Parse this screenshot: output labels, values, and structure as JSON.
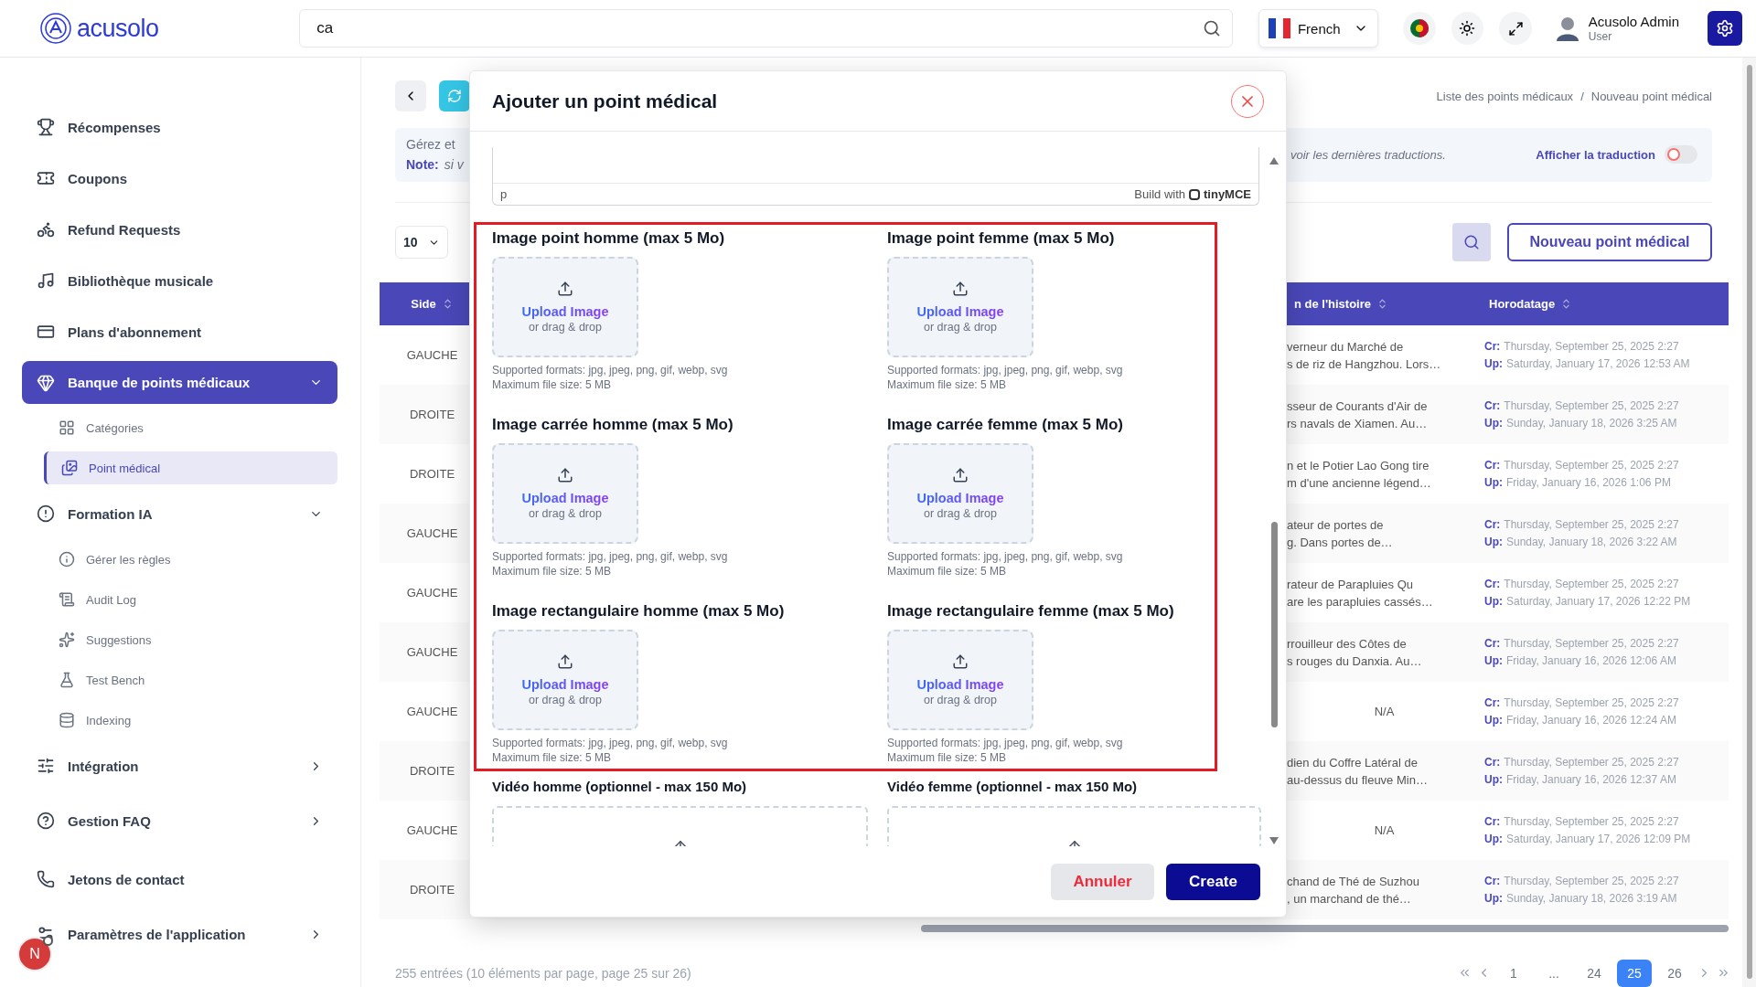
{
  "header": {
    "logo": "acusolo",
    "search": {
      "value": "ca"
    },
    "language": "French",
    "user": {
      "name": "Acusolo Admin",
      "role": "User"
    }
  },
  "sidebar": {
    "items": [
      {
        "label": "Récompenses",
        "selected": false
      },
      {
        "label": "Coupons",
        "selected": false
      },
      {
        "label": "Refund Requests",
        "selected": false
      },
      {
        "label": "Bibliothèque musicale",
        "selected": false
      },
      {
        "label": "Plans d'abonnement",
        "selected": false
      },
      {
        "label": "Banque de points médicaux",
        "selected": true,
        "expanded": true,
        "children": [
          {
            "label": "Catégories",
            "selected": false
          },
          {
            "label": "Point médical",
            "selected": true
          }
        ]
      },
      {
        "label": "Formation IA",
        "selected": false,
        "expanded": true,
        "children": [
          {
            "label": "Gérer les règles",
            "selected": false
          },
          {
            "label": "Audit Log",
            "selected": false
          },
          {
            "label": "Suggestions",
            "selected": false
          },
          {
            "label": "Test Bench",
            "selected": false
          },
          {
            "label": "Indexing",
            "selected": false
          }
        ]
      },
      {
        "label": "Intégration",
        "selected": false,
        "expanded": false
      },
      {
        "label": "Gestion FAQ",
        "selected": false,
        "expanded": false
      },
      {
        "label": "Jetons de contact",
        "selected": false
      },
      {
        "label": "Paramètres de l'application",
        "selected": false,
        "expanded": false
      }
    ]
  },
  "dev_badge": "N",
  "page": {
    "breadcrumb": {
      "items": [
        "Liste des points médicaux",
        "Nouveau point médical"
      ],
      "separator": "/"
    },
    "info": {
      "text": "Gérez et",
      "note_label": "Note:",
      "note_text": "si v",
      "right_text": "voir les dernières traductions."
    },
    "translation_toggle": {
      "label": "Afficher la traduction",
      "on": false
    },
    "per_page": "10",
    "new_button": "Nouveau point médical",
    "table": {
      "columns": [
        "Side",
        "",
        "n de l'histoire",
        "Horodatage"
      ],
      "rows": [
        {
          "side": "GAUCHE",
          "story": [
            "verneur du Marché de",
            "s de riz de Hangzhou. Lors…"
          ],
          "created_label": "Cr:",
          "created": "Thursday, September 25, 2025 2:27",
          "updated_label": "Up:",
          "updated": "Saturday, January 17, 2026 12:53 AM"
        },
        {
          "side": "DROITE",
          "story": [
            "sseur de Courants d'Air de",
            "rs navals de Xiamen. Au…"
          ],
          "created_label": "Cr:",
          "created": "Thursday, September 25, 2025 2:27",
          "updated_label": "Up:",
          "updated": "Sunday, January 18, 2026 3:25 AM"
        },
        {
          "side": "DROITE",
          "story": [
            "n et le Potier Lao Gong tire",
            "m d'une ancienne légend…"
          ],
          "created_label": "Cr:",
          "created": "Thursday, September 25, 2025 2:27",
          "updated_label": "Up:",
          "updated": "Friday, January 16, 2026 1:06 PM"
        },
        {
          "side": "GAUCHE",
          "story": [
            "ateur de portes de",
            "g. Dans portes de…"
          ],
          "created_label": "Cr:",
          "created": "Thursday, September 25, 2025 2:27",
          "updated_label": "Up:",
          "updated": "Sunday, January 18, 2026 3:22 AM"
        },
        {
          "side": "GAUCHE",
          "story": [
            "rateur de Parapluies Qu",
            "are les parapluies cassés…"
          ],
          "created_label": "Cr:",
          "created": "Thursday, September 25, 2025 2:27",
          "updated_label": "Up:",
          "updated": "Saturday, January 17, 2026 12:22 PM"
        },
        {
          "side": "GAUCHE",
          "story": [
            "rrouilleur des Côtes de",
            "s rouges du Danxia. Au…"
          ],
          "created_label": "Cr:",
          "created": "Thursday, September 25, 2025 2:27",
          "updated_label": "Up:",
          "updated": "Friday, January 16, 2026 12:06 AM"
        },
        {
          "side": "GAUCHE",
          "story": [
            "N/A"
          ],
          "created_label": "Cr:",
          "created": "Thursday, September 25, 2025 2:27",
          "updated_label": "Up:",
          "updated": "Friday, January 16, 2026 12:24 AM"
        },
        {
          "side": "DROITE",
          "story": [
            "dien du Coffre Latéral de",
            "au-dessus du fleuve Min…"
          ],
          "created_label": "Cr:",
          "created": "Thursday, September 25, 2025 2:27",
          "updated_label": "Up:",
          "updated": "Friday, January 16, 2026 12:37 AM"
        },
        {
          "side": "GAUCHE",
          "story": [
            "N/A"
          ],
          "created_label": "Cr:",
          "created": "Thursday, September 25, 2025 2:27",
          "updated_label": "Up:",
          "updated": "Saturday, January 17, 2026 12:09 PM"
        },
        {
          "side": "DROITE",
          "story": [
            "chand de Thé de Suzhou",
            ", un marchand de thé…"
          ],
          "created_label": "Cr:",
          "created": "Thursday, September 25, 2025 2:27",
          "updated_label": "Up:",
          "updated": "Sunday, January 18, 2026 3:19 AM"
        }
      ]
    },
    "footer": "255 entrées (10 éléments par page, page 25 sur 26)",
    "pagination": [
      {
        "label": "1",
        "selected": false
      },
      {
        "label": "...",
        "selected": false
      },
      {
        "label": "24",
        "selected": false
      },
      {
        "label": "25",
        "selected": true
      },
      {
        "label": "26",
        "selected": false
      }
    ]
  },
  "modal": {
    "title": "Ajouter un point médical",
    "editor": {
      "path": "p",
      "branding": "Build with",
      "brand": "tinyMCE"
    },
    "image_fields": [
      {
        "label": "Image point homme (max 5 Mo)",
        "upload": "Upload Image",
        "hint": "or drag & drop",
        "formats": "Supported formats: jpg, jpeg, png, gif, webp, svg",
        "max_size": "Maximum file size: 5 MB"
      },
      {
        "label": "Image point femme (max 5 Mo)",
        "upload": "Upload Image",
        "hint": "or drag & drop",
        "formats": "Supported formats: jpg, jpeg, png, gif, webp, svg",
        "max_size": "Maximum file size: 5 MB"
      },
      {
        "label": "Image carrée homme (max 5 Mo)",
        "upload": "Upload Image",
        "hint": "or drag & drop",
        "formats": "Supported formats: jpg, jpeg, png, gif, webp, svg",
        "max_size": "Maximum file size: 5 MB"
      },
      {
        "label": "Image carrée femme (max 5 Mo)",
        "upload": "Upload Image",
        "hint": "or drag & drop",
        "formats": "Supported formats: jpg, jpeg, png, gif, webp, svg",
        "max_size": "Maximum file size: 5 MB"
      },
      {
        "label": "Image rectangulaire homme (max 5 Mo)",
        "upload": "Upload Image",
        "hint": "or drag & drop",
        "formats": "Supported formats: jpg, jpeg, png, gif, webp, svg",
        "max_size": "Maximum file size: 5 MB"
      },
      {
        "label": "Image rectangulaire femme (max 5 Mo)",
        "upload": "Upload Image",
        "hint": "or drag & drop",
        "formats": "Supported formats: jpg, jpeg, png, gif, webp, svg",
        "max_size": "Maximum file size: 5 MB"
      }
    ],
    "video_fields": [
      {
        "label": "Vidéo homme (optionnel - max 150 Mo)"
      },
      {
        "label": "Vidéo femme (optionnel - max 150 Mo)"
      }
    ],
    "buttons": [
      {
        "label": "Annuler",
        "kind": "cancel"
      },
      {
        "label": "Create",
        "kind": "primary"
      }
    ]
  }
}
